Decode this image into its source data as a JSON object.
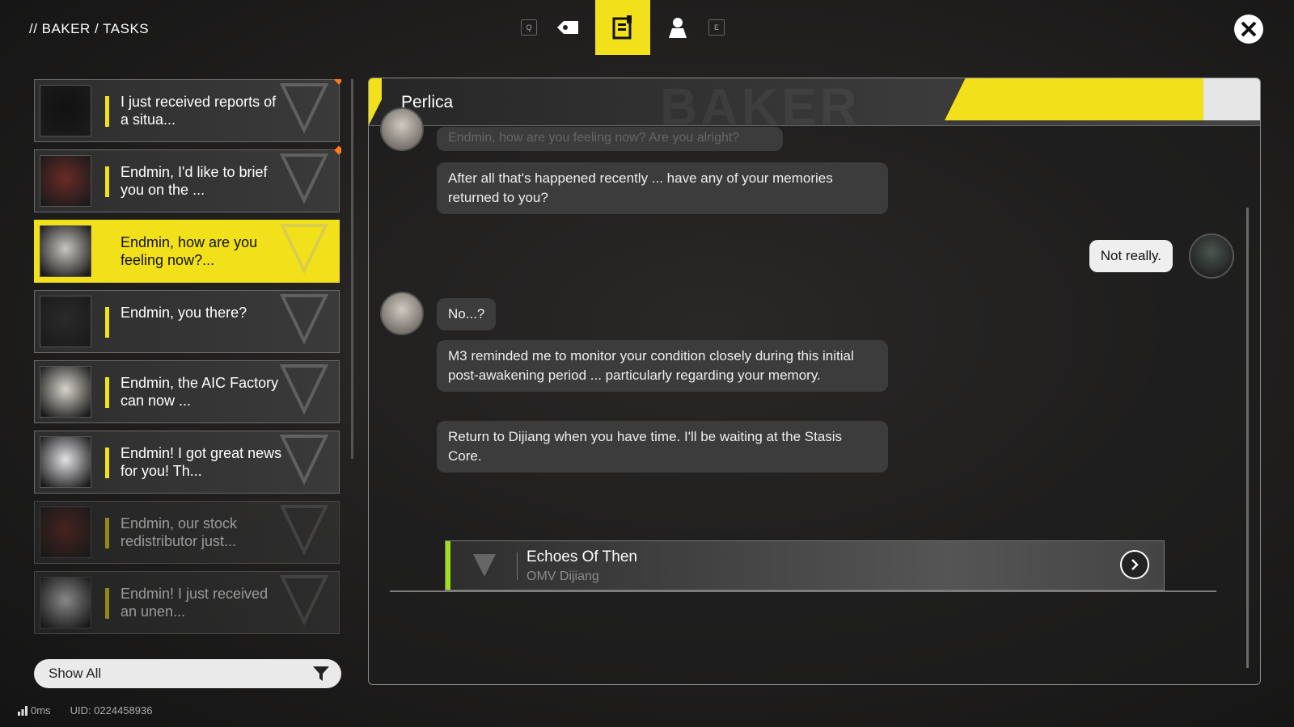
{
  "header": {
    "breadcrumb": "// BAKER / TASKS",
    "tabs": [
      {
        "key": "Q"
      },
      {
        "icon": "ticket-icon"
      },
      {
        "icon": "task-board-icon",
        "active": true
      },
      {
        "icon": "profile-icon"
      },
      {
        "key": "E"
      }
    ]
  },
  "tasks": [
    {
      "text": "I just received reports of a situa...",
      "avatar": "emblem",
      "new": true,
      "dim": false
    },
    {
      "text": "Endmin, I'd like to brief you on the ...",
      "avatar": "red-hair",
      "new": true,
      "dim": false
    },
    {
      "text": "Endmin, how are you feeling now?...",
      "avatar": "silver-hair",
      "active": true,
      "dim": false
    },
    {
      "text": "Endmin, you there?",
      "avatar": "capped",
      "dim": false
    },
    {
      "text": "Endmin, the AIC Factory can now ...",
      "avatar": "owl",
      "dim": false
    },
    {
      "text": "Endmin! I got great news for you! Th...",
      "avatar": "white-hair",
      "dim": false
    },
    {
      "text": "Endmin, our stock redistributor just...",
      "avatar": "red-hair",
      "dim": true
    },
    {
      "text": "Endmin! I just received an unen...",
      "avatar": "white-hair",
      "dim": true
    }
  ],
  "filter": {
    "label": "Show All"
  },
  "status": {
    "ping": "0ms",
    "uid": "UID: 0224458936"
  },
  "chat": {
    "contact": "Perlica",
    "header_watermark": "BAKER",
    "cutoff_text": "Endmin, how are you feeling now? Are you alright?",
    "messages": [
      "After all that's happened recently ... have any of your memories returned to you?",
      "Not really.",
      "No...?",
      "M3 reminded me to monitor your condition closely during this initial post-awakening period ... particularly regarding your memory.",
      "Return to Dijiang when you have time. I'll be waiting at the Stasis Core."
    ],
    "music": {
      "title": "Echoes Of Then",
      "subtitle": "OMV Dijiang"
    }
  },
  "colors": {
    "accent": "#f2e11a",
    "new_badge": "#ff7a1a",
    "music_accent": "#9fe01a"
  }
}
